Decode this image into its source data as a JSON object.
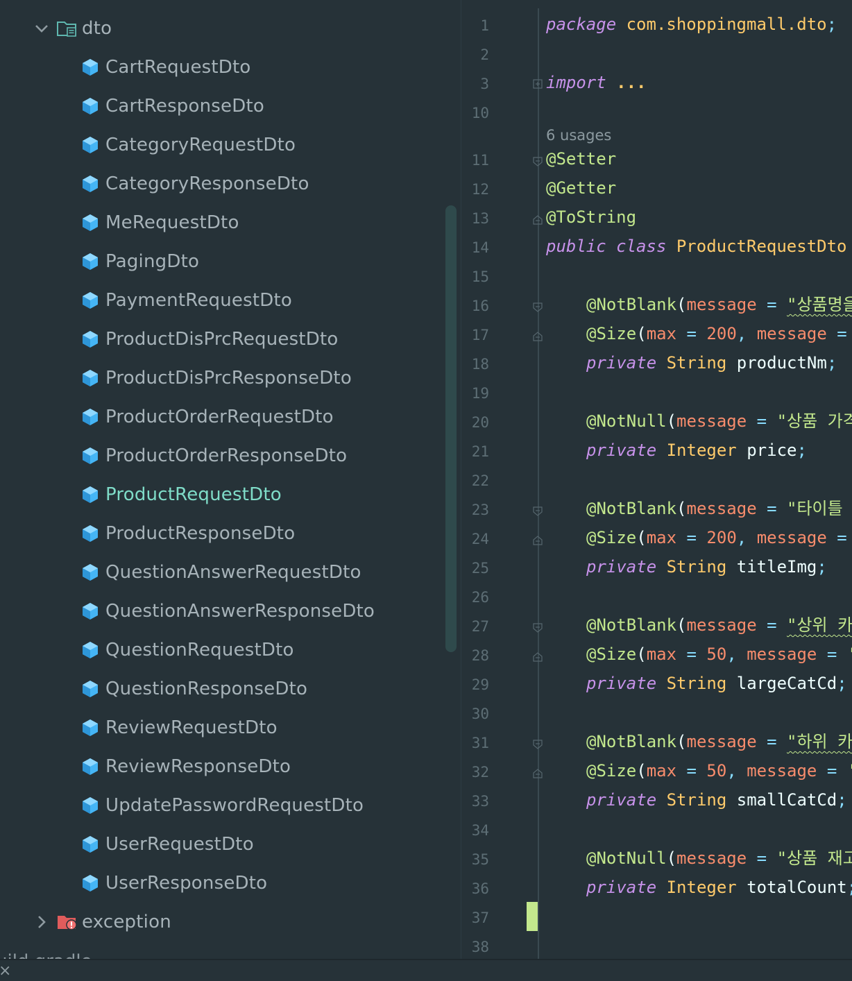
{
  "tree": {
    "dto_folder": "dto",
    "files": [
      "CartRequestDto",
      "CartResponseDto",
      "CategoryRequestDto",
      "CategoryResponseDto",
      "MeRequestDto",
      "PagingDto",
      "PaymentRequestDto",
      "ProductDisPrcRequestDto",
      "ProductDisPrcResponseDto",
      "ProductOrderRequestDto",
      "ProductOrderResponseDto",
      "ProductRequestDto",
      "ProductResponseDto",
      "QuestionAnswerRequestDto",
      "QuestionAnswerResponseDto",
      "QuestionRequestDto",
      "QuestionResponseDto",
      "ReviewRequestDto",
      "ReviewResponseDto",
      "UpdatePasswordRequestDto",
      "UserRequestDto",
      "UserResponseDto"
    ],
    "selected_file": "ProductRequestDto",
    "exception_folder": "exception",
    "cut_off_item": "uild.gradle"
  },
  "editor": {
    "line_numbers": [
      "1",
      "2",
      "3",
      "10",
      "11",
      "12",
      "13",
      "14",
      "15",
      "16",
      "17",
      "18",
      "19",
      "20",
      "21",
      "22",
      "23",
      "24",
      "25",
      "26",
      "27",
      "28",
      "29",
      "30",
      "31",
      "32",
      "33",
      "34",
      "35",
      "36",
      "37",
      "38"
    ],
    "usages_hint": "6 usages",
    "tokens": {
      "package_kw": "package",
      "package_name": "com.shoppingmall.dto",
      "semi": ";",
      "import_kw": "import",
      "import_dots": "...",
      "setter": "@Setter",
      "getter": "@Getter",
      "tostring": "@ToString",
      "public_kw": "public",
      "class_kw": "class",
      "class_name": "ProductRequestDto",
      "private_kw": "private",
      "string_type": "String",
      "integer_type": "Integer",
      "notblank_ann": "@NotBlank",
      "notnull_ann": "@NotNull",
      "size_ann": "@Size",
      "paren": "(",
      "message_attr": "message",
      "max_attr": "max",
      "eq": "=",
      "comma": ",",
      "num_200": "200",
      "num_50": "50",
      "str_product_name": "\"상품명을",
      "str_product_price": "\"상품 가격",
      "str_title": "\"타이틀 (",
      "str_large_cat": "\"상위 카",
      "str_small_cat": "\"하위 카",
      "str_stock": "\"상품 재고",
      "str_quote": "'",
      "field_productNm": "productNm",
      "field_price": "price",
      "field_titleImg": "titleImg",
      "field_largeCatCd": "largeCatCd",
      "field_smallCatCd": "smallCatCd",
      "field_totalCount": "totalCount"
    }
  },
  "bottom": {
    "close_glyph": "×"
  },
  "colors": {
    "background": "#263238",
    "keyword": "#c792ea",
    "type": "#ffcb6b",
    "annotation": "#c3e88d",
    "attribute": "#f78c6c",
    "string": "#c3e88d",
    "selected_file": "#7fdcc8",
    "caret_marker": "#c3e88d"
  }
}
